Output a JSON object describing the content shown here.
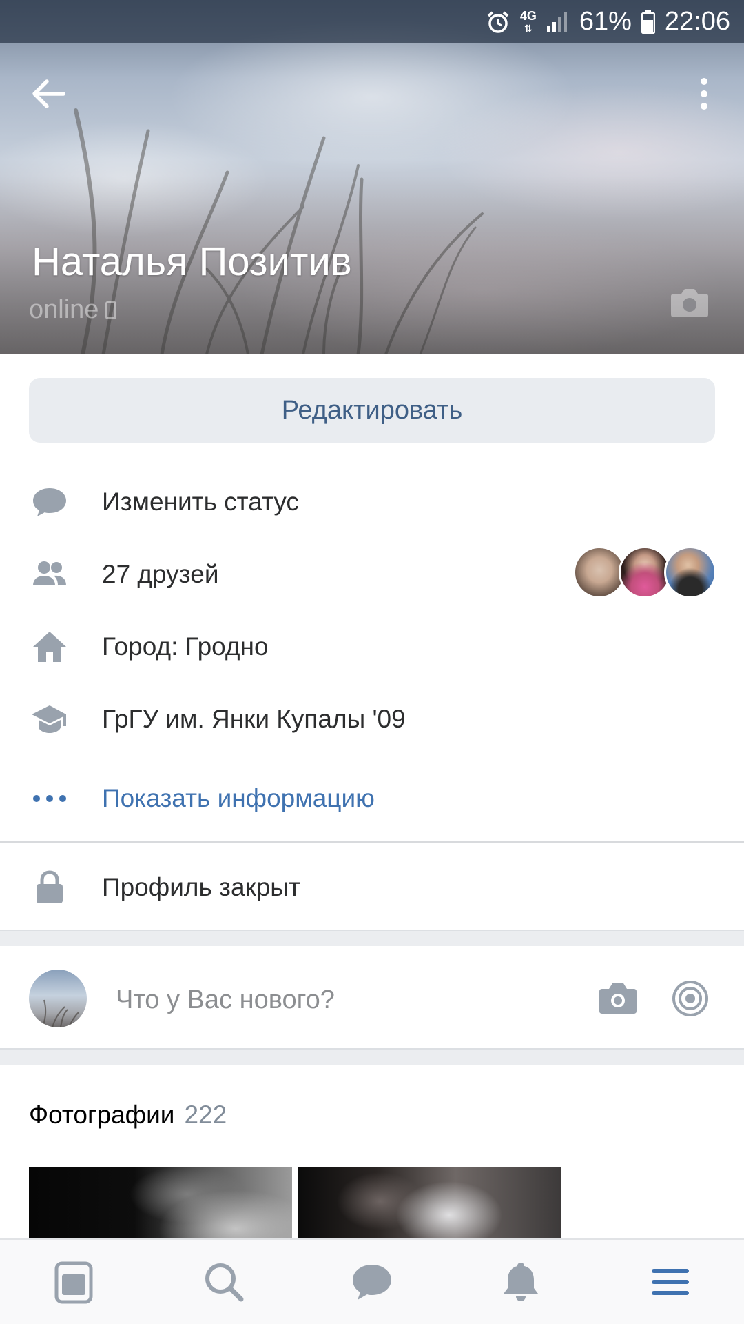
{
  "status_bar": {
    "network": "4G",
    "battery": "61%",
    "time": "22:06"
  },
  "profile": {
    "name": "Наталья Позитив",
    "online": "online"
  },
  "actions": {
    "edit_label": "Редактировать"
  },
  "info": {
    "status_label": "Изменить статус",
    "friends_label": "27 друзей",
    "city_label": "Город: Гродно",
    "education_label": "ГрГУ им. Янки Купалы '09",
    "show_info_label": "Показать информацию",
    "private_label": "Профиль закрыт"
  },
  "composer": {
    "placeholder": "Что у Вас нового?"
  },
  "photos": {
    "title": "Фотографии",
    "count": "222"
  },
  "colors": {
    "accent": "#3f72b0",
    "edit_text": "#3f5f86",
    "icon_gray": "#99a2ad",
    "tab_active": "#3f72b0"
  },
  "icons": {
    "tabbar": [
      "news-icon",
      "search-icon",
      "messages-icon",
      "notifications-icon",
      "menu-icon"
    ]
  }
}
